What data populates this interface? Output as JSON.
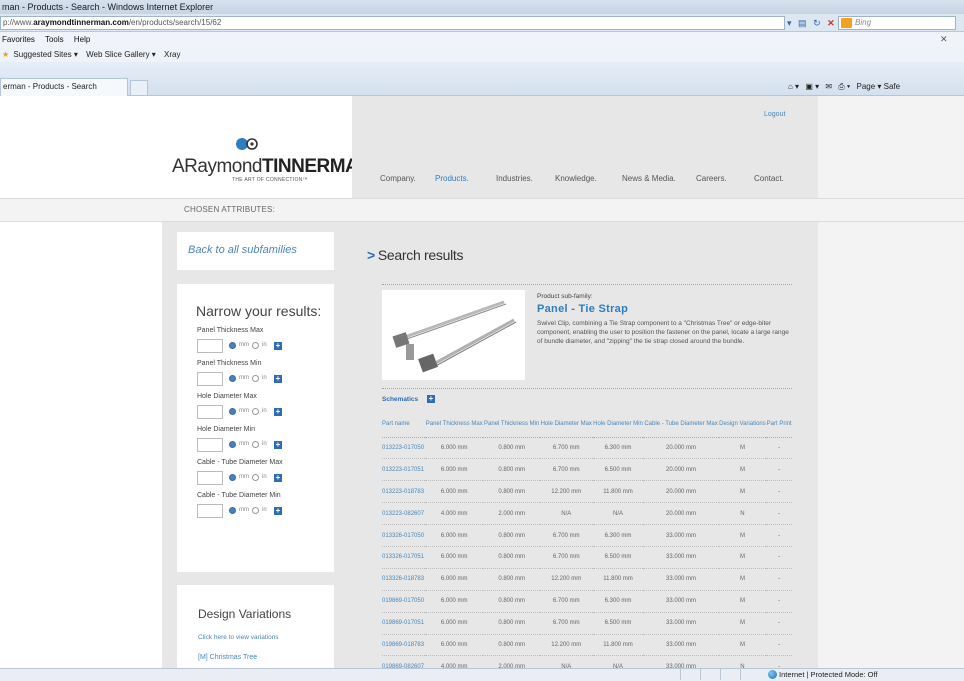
{
  "browser": {
    "window_title": "man - Products - Search - Windows Internet Explorer",
    "url_prefix": "p://www.",
    "url_domain": "araymondtinnerman.com",
    "url_path": "/en/products/search/15/62",
    "search_placeholder": "Bing",
    "menu": [
      "Favorites",
      "Tools",
      "Help"
    ],
    "favorites_bar": [
      "Suggested Sites ▾",
      "Web Slice Gallery ▾",
      "Xray"
    ],
    "tab_title": "erman - Products - Search",
    "command_bar": "Page ▾  Safe",
    "status_text": "Internet | Protected Mode: Off"
  },
  "site": {
    "logo_text_light": "ARaymond",
    "logo_text_bold": "TINNERMAN",
    "logo_tagline": "THE ART OF CONNECTION™",
    "logout": "Logout",
    "nav": [
      "Company.",
      "Products.",
      "Industries.",
      "Knowledge.",
      "News & Media.",
      "Careers.",
      "Contact."
    ],
    "chosen_attributes": "CHOSEN ATTRIBUTES:"
  },
  "sidebar": {
    "back_link": "Back to all subfamilies",
    "narrow_title": "Narrow your results:",
    "filters": [
      {
        "label": "Panel Thickness Max"
      },
      {
        "label": "Panel Thickness Min"
      },
      {
        "label": "Hole Diameter Max"
      },
      {
        "label": "Hole Diameter Min"
      },
      {
        "label": "Cable - Tube Diameter Max"
      },
      {
        "label": "Cable - Tube Diameter Min"
      }
    ],
    "unit_mm": "mm",
    "unit_in": "in",
    "design_title": "Design Variations",
    "design_link": "Click here to view variations",
    "design_item": "[M] Christmas Tree"
  },
  "results": {
    "title": "Search results",
    "subfamily_label": "Product sub-family:",
    "subfamily_name": "Panel - Tie Strap",
    "subfamily_desc": "Swivel Clip, combining a Tie Strap component to a \"Christmas Tree\" or edge-biter component, enabling the user to position the fastener on the panel, locate a large range of bundle diameter, and \"zipping\" the tie strap closed around the bundle.",
    "schematics": "Schematics",
    "columns": [
      "Part name",
      "Panel Thickness Max",
      "Panel Thickness Min",
      "Hole Diameter Max",
      "Hole Diameter Min",
      "Cable - Tube Diameter Max",
      "Design Variations",
      "Part Print"
    ],
    "rows": [
      [
        "013223-017050",
        "6.000 mm",
        "0.800 mm",
        "6.700 mm",
        "6.300 mm",
        "20.000 mm",
        "M",
        "-"
      ],
      [
        "013223-017051",
        "6.000 mm",
        "0.800 mm",
        "6.700 mm",
        "6.500 mm",
        "20.000 mm",
        "M",
        "-"
      ],
      [
        "013223-018783",
        "6.000 mm",
        "0.800 mm",
        "12.200 mm",
        "11.800 mm",
        "20.000 mm",
        "M",
        "-"
      ],
      [
        "013223-082607",
        "4.000 mm",
        "2.000 mm",
        "N/A",
        "N/A",
        "20.000 mm",
        "N",
        "-"
      ],
      [
        "013326-017050",
        "6.000 mm",
        "0.800 mm",
        "6.700 mm",
        "6.300 mm",
        "33.000 mm",
        "M",
        "-"
      ],
      [
        "013326-017051",
        "6.000 mm",
        "0.800 mm",
        "6.700 mm",
        "6.500 mm",
        "33.000 mm",
        "M",
        "-"
      ],
      [
        "013326-018783",
        "6.000 mm",
        "0.800 mm",
        "12.200 mm",
        "11.800 mm",
        "33.000 mm",
        "M",
        "-"
      ],
      [
        "019869-017050",
        "6.000 mm",
        "0.800 mm",
        "6.700 mm",
        "6.300 mm",
        "33.000 mm",
        "M",
        "-"
      ],
      [
        "019869-017051",
        "6.000 mm",
        "0.800 mm",
        "6.700 mm",
        "6.500 mm",
        "33.000 mm",
        "M",
        "-"
      ],
      [
        "019869-018783",
        "6.000 mm",
        "0.800 mm",
        "12.200 mm",
        "11.800 mm",
        "33.000 mm",
        "M",
        "-"
      ],
      [
        "019869-082607",
        "4.000 mm",
        "2.000 mm",
        "N/A",
        "N/A",
        "33.000 mm",
        "N",
        "-"
      ]
    ]
  },
  "colors": {
    "accent": "#2f7cbf",
    "link": "#4a86b8",
    "panel": "#e7e7e7"
  }
}
